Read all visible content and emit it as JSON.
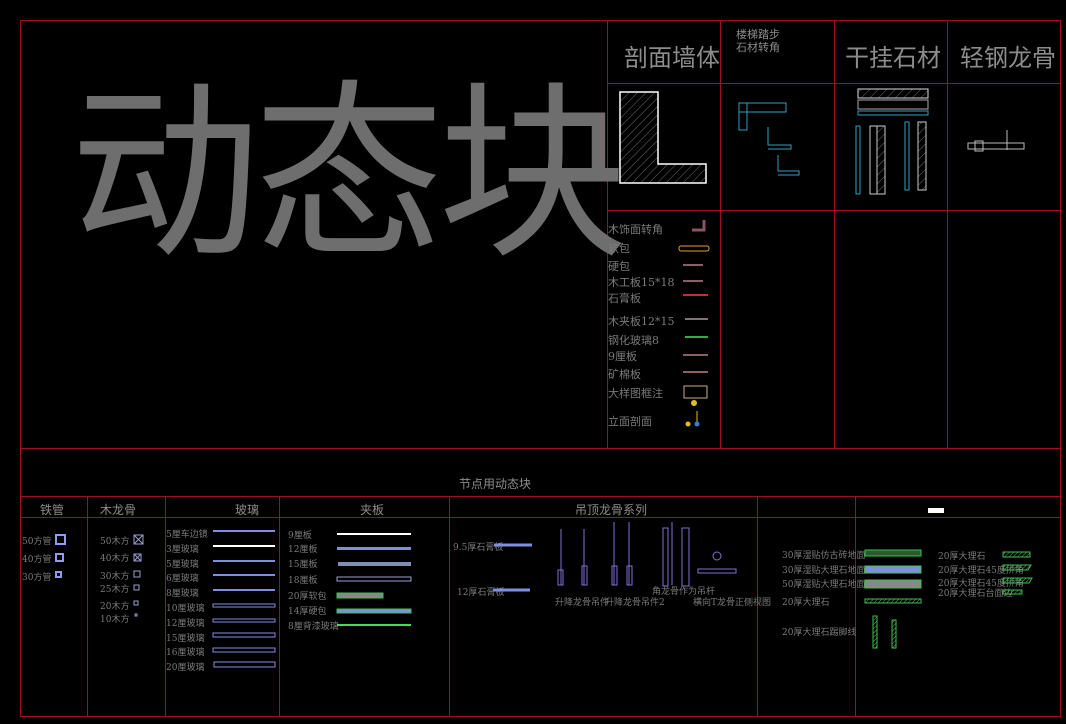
{
  "title": "动态块",
  "top_headers": [
    "剖面墙体",
    "楼梯踏步\n石材转角",
    "干挂石材",
    "轻钢龙骨"
  ],
  "legend": [
    "木饰面转角",
    "软包",
    "硬包",
    "木工板15*18",
    "石膏板",
    "木夹板12*15",
    "钢化玻璃8",
    "9厘板",
    "矿棉板",
    "大样图框注",
    "立面剖面"
  ],
  "legend_colors": [
    "#8a5560",
    "#e0a030",
    "#8a6060",
    "#8a6060",
    "#c03030",
    "#8a7070",
    "#30b040",
    "#8a6060",
    "#8a6060",
    "#c8b080",
    ""
  ],
  "section_title": "节点用动态块",
  "columns": [
    "铁管",
    "木龙骨",
    "玻璃",
    "夹板",
    "吊顶龙骨系列",
    "",
    ""
  ],
  "steel": [
    "50方管",
    "40方管",
    "30方管"
  ],
  "wood": [
    "50木方",
    "40木方",
    "30木方",
    "25木方",
    "20木方",
    "10木方"
  ],
  "glass": [
    "5厘车边镜",
    "3厘玻璃",
    "5厘玻璃",
    "6厘玻璃",
    "8厘玻璃",
    "10厘玻璃",
    "12厘玻璃",
    "15厘玻璃",
    "16厘玻璃",
    "20厘玻璃"
  ],
  "board": [
    "9厘板",
    "12厘板",
    "15厘板",
    "18厘板",
    "20厚软包",
    "14厚硬包",
    "8厘背漆玻璃"
  ],
  "ceiling": {
    "boards": [
      "9.5厚石膏板",
      "12厚石膏板"
    ],
    "hangers": [
      "升降龙骨吊件",
      "升降龙骨吊件2",
      "角龙骨作为吊杆",
      "横向T龙骨正侧视图"
    ]
  },
  "stone_left": [
    "30厚湿贴仿古砖地面",
    "30厚湿贴大理石地面",
    "50厚湿贴大理石地面",
    "20厚大理石",
    "20厚大理石踢脚线"
  ],
  "stone_right": [
    "20厚大理石",
    "20厚大理石45度拼角",
    "20厚大理石45度拼角",
    "20厚大理石台面边"
  ],
  "colors": {
    "frame": "#a0101c",
    "blue": "#7f8fe0",
    "green": "#40c050",
    "cyan": "#30a0c0"
  }
}
